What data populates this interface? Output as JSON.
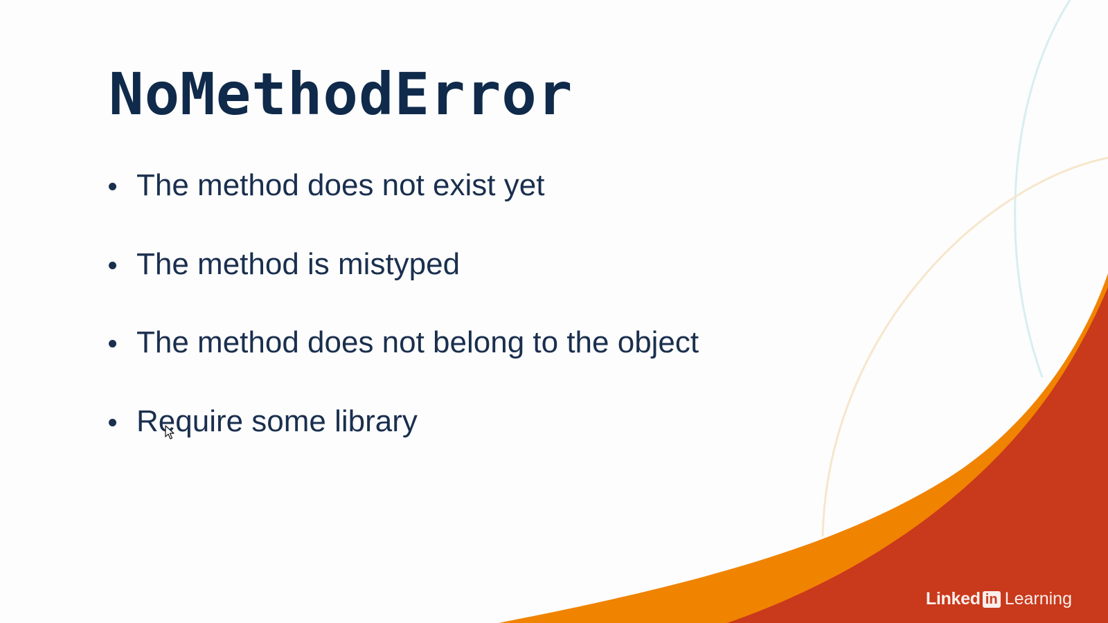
{
  "slide": {
    "title": "NoMethodError",
    "bullets": [
      "The method does not exist yet",
      "The method is mistyped",
      "The method does not belong to the object",
      "Require some library"
    ]
  },
  "branding": {
    "linked": "Linked",
    "in": "in",
    "learning": "Learning"
  },
  "colors": {
    "title": "#0f2a4a",
    "text": "#1a2f4e",
    "orange_wave": "#f08300",
    "red_wave": "#c9391b",
    "teal_curve": "#d8eef0",
    "peach_curve": "#f7e6cc"
  },
  "icons": [
    "mouse-cursor-icon",
    "linkedin-logo-icon"
  ]
}
